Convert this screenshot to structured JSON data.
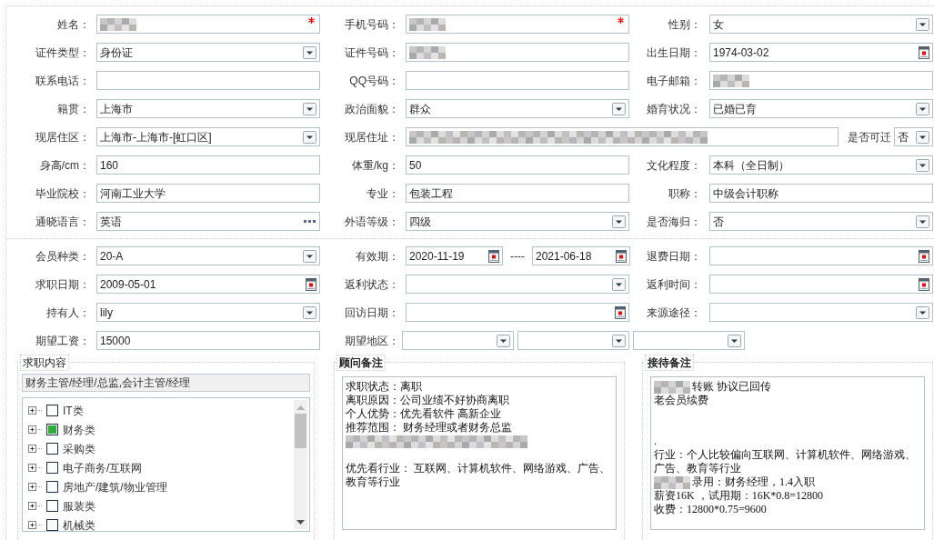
{
  "profile": {
    "rows": [
      [
        {
          "label": "姓名：",
          "kind": "text",
          "required": true,
          "redacted": true
        },
        {
          "label": "手机号码：",
          "kind": "text",
          "required": true,
          "redacted": true
        },
        {
          "label": "性别：",
          "kind": "select",
          "value": "女"
        }
      ],
      [
        {
          "label": "证件类型：",
          "kind": "select",
          "value": "身份证"
        },
        {
          "label": "证件号码：",
          "kind": "text",
          "redacted": true
        },
        {
          "label": "出生日期：",
          "kind": "date",
          "value": "1974-03-02"
        }
      ],
      [
        {
          "label": "联系电话：",
          "kind": "text"
        },
        {
          "label": "QQ号码：",
          "kind": "text"
        },
        {
          "label": "电子邮箱：",
          "kind": "text",
          "redacted": true
        }
      ],
      [
        {
          "label": "籍贯：",
          "kind": "select",
          "value": "上海市"
        },
        {
          "label": "政治面貌：",
          "kind": "select",
          "value": "群众"
        },
        {
          "label": "婚育状况：",
          "kind": "select",
          "value": "已婚已育"
        }
      ],
      [
        {
          "label": "现居住区：",
          "kind": "select",
          "value": "上海市-上海市-[虹口区]"
        },
        {
          "label": "现居住址：",
          "kind": "address",
          "redacted": true,
          "extra": {
            "label": "是否可迁",
            "value": "否"
          }
        }
      ],
      [
        {
          "label": "身高/cm：",
          "kind": "text",
          "value": "160"
        },
        {
          "label": "体重/kg：",
          "kind": "text",
          "value": "50"
        },
        {
          "label": "文化程度：",
          "kind": "select",
          "value": "本科（全日制）"
        }
      ],
      [
        {
          "label": "毕业院校：",
          "kind": "text",
          "value": "河南工业大学"
        },
        {
          "label": "专业：",
          "kind": "text",
          "value": "包装工程"
        },
        {
          "label": "职称：",
          "kind": "text",
          "value": "中级会计职称"
        }
      ],
      [
        {
          "label": "通晓语言：",
          "kind": "lookup",
          "value": "英语"
        },
        {
          "label": "外语等级：",
          "kind": "select",
          "value": "四级"
        },
        {
          "label": "是否海归：",
          "kind": "select",
          "value": "否"
        }
      ]
    ]
  },
  "membership": {
    "rows": [
      [
        {
          "label": "会员种类：",
          "kind": "select",
          "value": "20-A"
        },
        {
          "label": "有效期：",
          "kind": "date_range",
          "value": "2020-11-19",
          "separator": "----",
          "to": "2021-06-18"
        },
        {
          "label": "退费日期：",
          "kind": "date"
        }
      ],
      [
        {
          "label": "求职日期：",
          "kind": "date",
          "value": "2009-05-01"
        },
        {
          "label": "返利状态：",
          "kind": "select"
        },
        {
          "label": "返利时间：",
          "kind": "date"
        }
      ],
      [
        {
          "label": "持有人：",
          "kind": "select",
          "value": "lily"
        },
        {
          "label": "回访日期：",
          "kind": "date"
        },
        {
          "label": "来源途径：",
          "kind": "select"
        }
      ],
      [
        {
          "label": "期望工资：",
          "kind": "text",
          "value": "15000"
        },
        {
          "label": "期望地区：",
          "kind": "region"
        }
      ]
    ]
  },
  "job_intent": {
    "legend": "求职内容",
    "selection": "财务主管/经理/总监,会计主管/经理",
    "categories": [
      {
        "label": "IT类",
        "checked": false
      },
      {
        "label": "财务类",
        "checked": true
      },
      {
        "label": "采购类",
        "checked": false
      },
      {
        "label": "电子商务/互联网",
        "checked": false
      },
      {
        "label": "房地产/建筑/物业管理",
        "checked": false
      },
      {
        "label": "服装类",
        "checked": false
      },
      {
        "label": "机械类",
        "checked": false
      }
    ]
  },
  "advisor_notes": {
    "legend": "顾问备注",
    "lines": [
      {
        "kind": "text",
        "text": "求职状态：离职"
      },
      {
        "kind": "text",
        "text": "离职原因：公司业绩不好协商离职"
      },
      {
        "kind": "text",
        "text": "个人优势：优先看软件 高新企业"
      },
      {
        "kind": "text",
        "text": "推荐范围： 财务经理或者财务总监"
      },
      {
        "kind": "masked"
      },
      {
        "kind": "blank"
      },
      {
        "kind": "text",
        "text": "优先看行业： 互联网、计算机软件、网络游戏、广告、教育等行业"
      }
    ]
  },
  "reception_notes": {
    "legend": "接待备注",
    "lines": [
      {
        "kind": "masked_text",
        "text": "转账 协议已回传"
      },
      {
        "kind": "text",
        "text": "老会员续费"
      },
      {
        "kind": "blank"
      },
      {
        "kind": "blank"
      },
      {
        "kind": "text",
        "text": "."
      },
      {
        "kind": "text",
        "text": "行业：个人比较偏向互联网、计算机软件、网络游戏、广告、教育等行业"
      },
      {
        "kind": "masked_text",
        "text": "录用：财务经理，1.4入职"
      },
      {
        "kind": "text",
        "text": "薪资16K ，试用期：16K*0.8=12800"
      },
      {
        "kind": "text",
        "text": "收费：12800*0.75=9600"
      }
    ]
  }
}
